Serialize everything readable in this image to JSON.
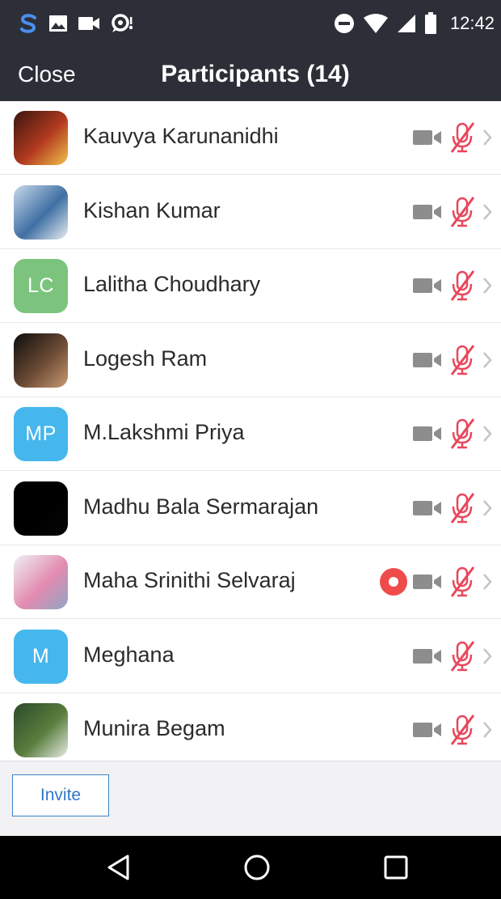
{
  "status_bar": {
    "time": "12:42",
    "left_icons": [
      "s-logo-icon",
      "image-icon",
      "video-camera-icon",
      "chat-bubble-icon"
    ],
    "right_icons": [
      "do-not-disturb-icon",
      "wifi-icon",
      "signal-icon",
      "battery-icon"
    ]
  },
  "header": {
    "close_label": "Close",
    "title": "Participants (14)"
  },
  "participants": [
    {
      "name": "Kauvya Karunanidhi",
      "avatar_type": "photo",
      "avatar_colors": [
        "#3a1510",
        "#b23a1f",
        "#f2c14a"
      ],
      "video_muted": true,
      "audio_muted": true,
      "recording": false
    },
    {
      "name": "Kishan Kumar",
      "avatar_type": "photo",
      "avatar_colors": [
        "#c9d9ea",
        "#3f6fa3",
        "#e8eef3"
      ],
      "video_muted": true,
      "audio_muted": true,
      "recording": false
    },
    {
      "name": "Lalitha Choudhary",
      "avatar_type": "initials",
      "initials": "LC",
      "avatar_color": "#7cc47e",
      "video_muted": true,
      "audio_muted": true,
      "recording": false
    },
    {
      "name": "Logesh Ram",
      "avatar_type": "photo",
      "avatar_colors": [
        "#0d0d0d",
        "#6b4a34",
        "#c99a74"
      ],
      "video_muted": true,
      "audio_muted": true,
      "recording": false
    },
    {
      "name": "M.Lakshmi Priya",
      "avatar_type": "initials",
      "initials": "MP",
      "avatar_color": "#46b7ec",
      "video_muted": true,
      "audio_muted": true,
      "recording": false
    },
    {
      "name": "Madhu Bala Sermarajan",
      "avatar_type": "photo",
      "avatar_colors": [
        "#000000",
        "#000000",
        "#050505"
      ],
      "video_muted": true,
      "audio_muted": true,
      "recording": false
    },
    {
      "name": "Maha Srinithi Selvaraj",
      "avatar_type": "photo",
      "avatar_colors": [
        "#eef0f4",
        "#e38bb0",
        "#8fa6c4"
      ],
      "video_muted": true,
      "audio_muted": true,
      "recording": true
    },
    {
      "name": "Meghana",
      "avatar_type": "initials",
      "initials": "M",
      "avatar_color": "#46b7ec",
      "video_muted": true,
      "audio_muted": true,
      "recording": false
    },
    {
      "name": "Munira Begam",
      "avatar_type": "photo",
      "avatar_colors": [
        "#2b4a2a",
        "#5a7d3e",
        "#e6ebe3"
      ],
      "video_muted": true,
      "audio_muted": true,
      "recording": false
    }
  ],
  "footer": {
    "invite_label": "Invite"
  },
  "android_nav": [
    "back-icon",
    "home-icon",
    "recents-icon"
  ],
  "colors": {
    "bar_background": "#2d2f38",
    "muted_mic": "#e8475c",
    "camera": "#8d8d8d",
    "chevron": "#c4c4c4",
    "invite_accent": "#2f77c9",
    "recording": "#ef4b4b"
  }
}
